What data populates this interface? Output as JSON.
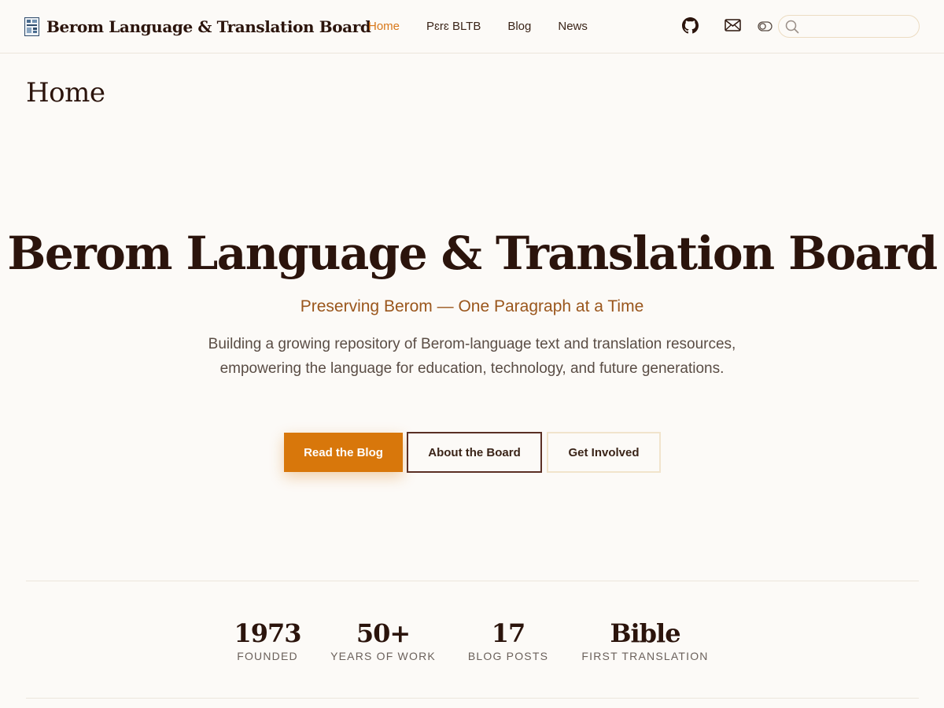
{
  "header": {
    "brand_title": "Berom Language & Translation Board",
    "nav": [
      {
        "label": "Home",
        "active": true
      },
      {
        "label": "Pɛrɛ BLTB",
        "active": false
      },
      {
        "label": "Blog",
        "active": false
      },
      {
        "label": "News",
        "active": false
      }
    ],
    "icons": [
      "github-icon",
      "mail-icon",
      "theme-toggle-icon",
      "search-icon"
    ],
    "search_placeholder": ""
  },
  "page": {
    "title": "Home"
  },
  "hero": {
    "title": "Berom Language & Translation Board",
    "subtitle": "Preserving Berom — One Paragraph at a Time",
    "description": "Building a growing repository of Berom-language text and translation resources, empowering the language for education, technology, and future generations.",
    "buttons": {
      "primary": "Read the Blog",
      "secondary": "About the Board",
      "tertiary": "Get Involved"
    }
  },
  "stats": [
    {
      "value": "1973",
      "label": "FOUNDED"
    },
    {
      "value": "50+",
      "label": "YEARS OF WORK"
    },
    {
      "value": "17",
      "label": "BLOG POSTS"
    },
    {
      "value": "Bible",
      "label": "FIRST TRANSLATION"
    }
  ],
  "colors": {
    "accent": "#d8770b",
    "active_nav": "#d8781a",
    "subtitle": "#9a561c",
    "heading": "#2b140c",
    "background": "#fcfaf7"
  }
}
